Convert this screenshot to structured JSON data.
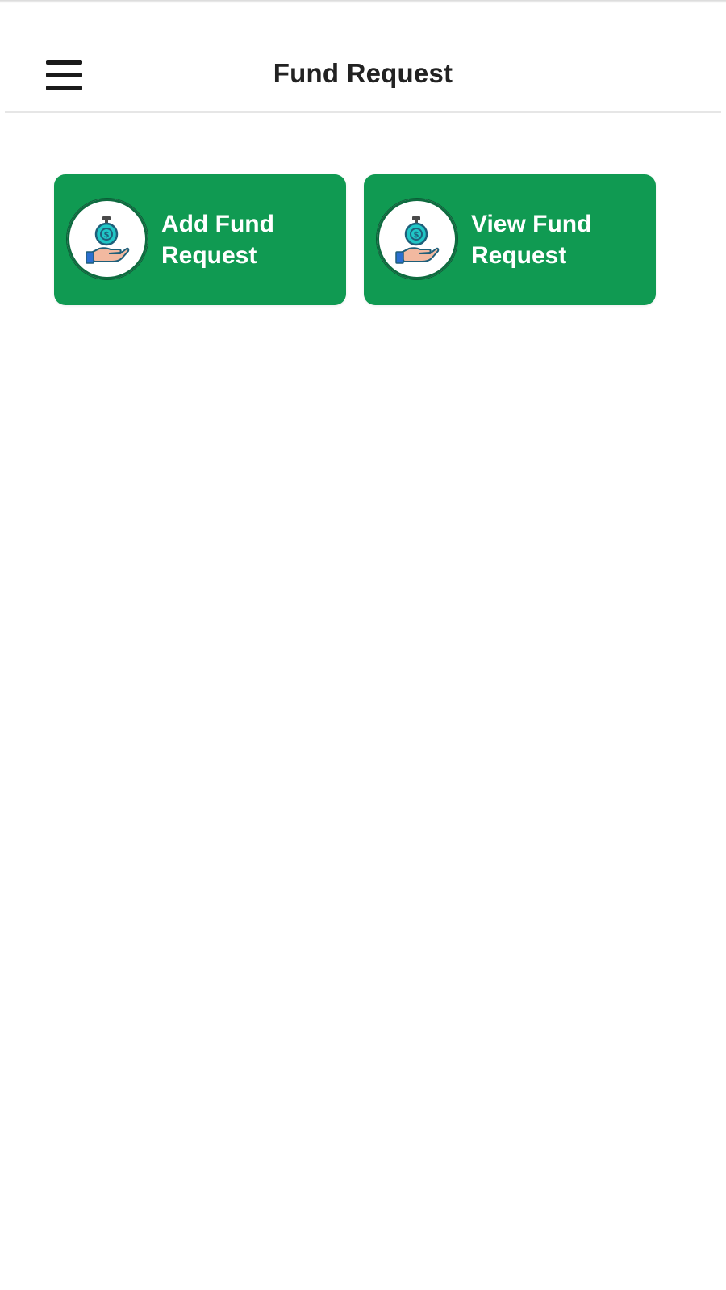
{
  "header": {
    "title": "Fund Request",
    "menu_icon": "hamburger-menu-icon"
  },
  "actions": [
    {
      "label": "Add Fund Request",
      "icon": "money-hand-icon"
    },
    {
      "label": "View Fund Request",
      "icon": "money-hand-icon"
    }
  ],
  "colors": {
    "accent": "#109a52",
    "card_text": "#ffffff",
    "title_text": "#222222"
  }
}
